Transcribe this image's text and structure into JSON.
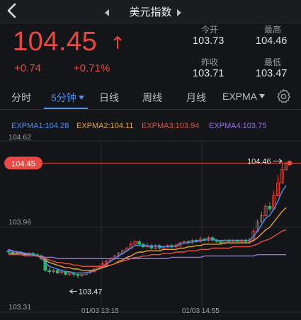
{
  "header": {
    "title": "美元指数"
  },
  "quote": {
    "price": "104.45",
    "change": "+0.74",
    "change_pct": "+0.71%",
    "open_label": "今开",
    "open": "103.73",
    "high_label": "最高",
    "high": "104.46",
    "prev_close_label": "昨收",
    "prev_close": "103.71",
    "low_label": "最低",
    "low": "103.47"
  },
  "tabs": [
    {
      "label": "分时"
    },
    {
      "label": "5分钟"
    },
    {
      "label": "日线"
    },
    {
      "label": "周线"
    },
    {
      "label": "月线"
    },
    {
      "label": "EXPMA"
    }
  ],
  "colors": {
    "up": "#e64a42",
    "down": "#2db36b",
    "accent": "#4a8ef0",
    "expma1": "#4a8ef0",
    "expma2": "#e8a33a",
    "expma3": "#e0503e",
    "expma4": "#9a6ee8"
  },
  "legend": {
    "expma1": "EXPMA1:104.28",
    "expma2": "EXPMA2:104.11",
    "expma3": "EXPMA3:103.94",
    "expma4": "EXPMA4:103.75"
  },
  "chart_data": {
    "type": "candlestick",
    "y_axis_labels": [
      "104.62",
      "103.96",
      "103.31"
    ],
    "ylim": [
      103.31,
      104.62
    ],
    "x_axis_labels": [
      "01/03 13:15",
      "01/03 14:55"
    ],
    "last_price_label": "104.45",
    "last_price": 104.45,
    "high_marker_label": "104.46",
    "high_marker": 104.46,
    "low_marker_label": "103.47",
    "low_marker": 103.47,
    "candles": [
      [
        103.78,
        103.77,
        103.79,
        103.76
      ],
      [
        103.77,
        103.76,
        103.78,
        103.75
      ],
      [
        103.76,
        103.77,
        103.78,
        103.75
      ],
      [
        103.77,
        103.76,
        103.78,
        103.75
      ],
      [
        103.76,
        103.75,
        103.77,
        103.74
      ],
      [
        103.75,
        103.76,
        103.77,
        103.74
      ],
      [
        103.76,
        103.75,
        103.77,
        103.74
      ],
      [
        103.75,
        103.74,
        103.76,
        103.73
      ],
      [
        103.74,
        103.72,
        103.75,
        103.71
      ],
      [
        103.72,
        103.63,
        103.73,
        103.62
      ],
      [
        103.63,
        103.62,
        103.65,
        103.6
      ],
      [
        103.62,
        103.63,
        103.64,
        103.61
      ],
      [
        103.63,
        103.61,
        103.64,
        103.6
      ],
      [
        103.61,
        103.62,
        103.63,
        103.6
      ],
      [
        103.62,
        103.6,
        103.63,
        103.59
      ],
      [
        103.6,
        103.61,
        103.62,
        103.59
      ],
      [
        103.61,
        103.6,
        103.62,
        103.58
      ],
      [
        103.6,
        103.59,
        103.61,
        103.57
      ],
      [
        103.59,
        103.6,
        103.61,
        103.58
      ],
      [
        103.6,
        103.61,
        103.62,
        103.59
      ],
      [
        103.61,
        103.62,
        103.63,
        103.6
      ],
      [
        103.62,
        103.64,
        103.65,
        103.61
      ],
      [
        103.64,
        103.66,
        103.67,
        103.63
      ],
      [
        103.66,
        103.68,
        103.7,
        103.65
      ],
      [
        103.68,
        103.7,
        103.71,
        103.67
      ],
      [
        103.7,
        103.72,
        103.73,
        103.69
      ],
      [
        103.72,
        103.74,
        103.75,
        103.71
      ],
      [
        103.74,
        103.76,
        103.77,
        103.73
      ],
      [
        103.76,
        103.78,
        103.79,
        103.75
      ],
      [
        103.78,
        103.8,
        103.81,
        103.77
      ],
      [
        103.8,
        103.83,
        103.85,
        103.79
      ],
      [
        103.83,
        103.85,
        103.86,
        103.82
      ],
      [
        103.85,
        103.83,
        103.86,
        103.82
      ],
      [
        103.83,
        103.81,
        103.84,
        103.8
      ],
      [
        103.81,
        103.82,
        103.84,
        103.8
      ],
      [
        103.82,
        103.8,
        103.83,
        103.79
      ],
      [
        103.8,
        103.82,
        103.83,
        103.79
      ],
      [
        103.82,
        103.8,
        103.83,
        103.79
      ],
      [
        103.8,
        103.81,
        103.82,
        103.79
      ],
      [
        103.81,
        103.82,
        103.83,
        103.8
      ],
      [
        103.82,
        103.81,
        103.83,
        103.8
      ],
      [
        103.81,
        103.82,
        103.84,
        103.8
      ],
      [
        103.82,
        103.84,
        103.85,
        103.81
      ],
      [
        103.84,
        103.85,
        103.86,
        103.83
      ],
      [
        103.85,
        103.84,
        103.86,
        103.83
      ],
      [
        103.84,
        103.86,
        103.87,
        103.83
      ],
      [
        103.86,
        103.85,
        103.87,
        103.84
      ],
      [
        103.85,
        103.87,
        103.89,
        103.84
      ],
      [
        103.87,
        103.86,
        103.88,
        103.85
      ],
      [
        103.86,
        103.88,
        103.89,
        103.85
      ],
      [
        103.88,
        103.86,
        103.89,
        103.85
      ],
      [
        103.86,
        103.85,
        103.87,
        103.84
      ],
      [
        103.85,
        103.84,
        103.86,
        103.83
      ],
      [
        103.84,
        103.86,
        103.87,
        103.83
      ],
      [
        103.86,
        103.85,
        103.87,
        103.84
      ],
      [
        103.85,
        103.86,
        103.87,
        103.84
      ],
      [
        103.86,
        103.85,
        103.87,
        103.84
      ],
      [
        103.85,
        103.86,
        103.87,
        103.84
      ],
      [
        103.86,
        103.85,
        103.87,
        103.84
      ],
      [
        103.85,
        103.86,
        103.88,
        103.84
      ],
      [
        103.86,
        103.93,
        103.95,
        103.85
      ],
      [
        103.93,
        104.0,
        104.02,
        103.92
      ],
      [
        104.0,
        104.05,
        104.08,
        103.99
      ],
      [
        104.05,
        104.12,
        104.14,
        104.04
      ],
      [
        104.12,
        104.1,
        104.15,
        104.08
      ],
      [
        104.1,
        104.2,
        104.24,
        104.09
      ],
      [
        104.2,
        104.3,
        104.36,
        104.19
      ],
      [
        104.3,
        104.4,
        104.46,
        104.29
      ],
      [
        104.4,
        104.45,
        104.46,
        104.39
      ]
    ],
    "series": [
      {
        "name": "EXPMA1",
        "values": [
          103.78,
          103.78,
          103.77,
          103.77,
          103.76,
          103.76,
          103.75,
          103.74,
          103.73,
          103.69,
          103.66,
          103.65,
          103.64,
          103.63,
          103.62,
          103.62,
          103.61,
          103.61,
          103.61,
          103.61,
          103.62,
          103.63,
          103.64,
          103.66,
          103.68,
          103.7,
          103.72,
          103.74,
          103.76,
          103.78,
          103.8,
          103.82,
          103.82,
          103.82,
          103.82,
          103.81,
          103.82,
          103.81,
          103.81,
          103.81,
          103.81,
          103.82,
          103.83,
          103.84,
          103.84,
          103.85,
          103.85,
          103.86,
          103.86,
          103.87,
          103.87,
          103.86,
          103.86,
          103.86,
          103.86,
          103.86,
          103.86,
          103.86,
          103.86,
          103.86,
          103.89,
          103.93,
          103.98,
          104.03,
          104.05,
          104.1,
          104.16,
          104.23,
          104.28
        ]
      },
      {
        "name": "EXPMA2",
        "values": [
          103.76,
          103.76,
          103.76,
          103.76,
          103.75,
          103.75,
          103.75,
          103.74,
          103.74,
          103.71,
          103.69,
          103.68,
          103.67,
          103.66,
          103.65,
          103.65,
          103.64,
          103.64,
          103.63,
          103.63,
          103.63,
          103.63,
          103.64,
          103.65,
          103.66,
          103.67,
          103.68,
          103.7,
          103.71,
          103.73,
          103.74,
          103.76,
          103.77,
          103.77,
          103.78,
          103.78,
          103.78,
          103.78,
          103.79,
          103.79,
          103.79,
          103.79,
          103.8,
          103.8,
          103.81,
          103.81,
          103.82,
          103.82,
          103.83,
          103.83,
          103.83,
          103.83,
          103.83,
          103.84,
          103.84,
          103.84,
          103.84,
          103.84,
          103.84,
          103.84,
          103.86,
          103.88,
          103.91,
          103.94,
          103.96,
          104.0,
          104.04,
          104.08,
          104.11
        ]
      },
      {
        "name": "EXPMA3",
        "values": [
          103.75,
          103.75,
          103.75,
          103.75,
          103.74,
          103.74,
          103.74,
          103.74,
          103.73,
          103.72,
          103.71,
          103.7,
          103.69,
          103.69,
          103.68,
          103.68,
          103.67,
          103.67,
          103.66,
          103.66,
          103.66,
          103.66,
          103.66,
          103.66,
          103.67,
          103.67,
          103.68,
          103.69,
          103.7,
          103.71,
          103.72,
          103.73,
          103.73,
          103.74,
          103.74,
          103.75,
          103.75,
          103.75,
          103.76,
          103.76,
          103.76,
          103.77,
          103.77,
          103.77,
          103.78,
          103.78,
          103.78,
          103.79,
          103.79,
          103.79,
          103.8,
          103.8,
          103.8,
          103.8,
          103.8,
          103.81,
          103.81,
          103.81,
          103.81,
          103.81,
          103.82,
          103.83,
          103.85,
          103.86,
          103.87,
          103.89,
          103.91,
          103.93,
          103.94
        ]
      },
      {
        "name": "EXPMA4",
        "values": [
          103.79,
          103.78,
          103.77,
          103.76,
          103.76,
          103.75,
          103.75,
          103.74,
          103.74,
          103.73,
          103.73,
          103.73,
          103.72,
          103.72,
          103.72,
          103.72,
          103.72,
          103.72,
          103.72,
          103.72,
          103.72,
          103.72,
          103.72,
          103.72,
          103.72,
          103.72,
          103.72,
          103.72,
          103.72,
          103.72,
          103.72,
          103.72,
          103.72,
          103.72,
          103.72,
          103.72,
          103.72,
          103.72,
          103.72,
          103.72,
          103.73,
          103.73,
          103.73,
          103.73,
          103.73,
          103.73,
          103.73,
          103.73,
          103.74,
          103.74,
          103.74,
          103.74,
          103.74,
          103.74,
          103.74,
          103.74,
          103.74,
          103.74,
          103.74,
          103.74,
          103.74,
          103.75,
          103.75,
          103.75,
          103.75,
          103.75,
          103.75,
          103.75,
          103.75
        ]
      }
    ]
  }
}
